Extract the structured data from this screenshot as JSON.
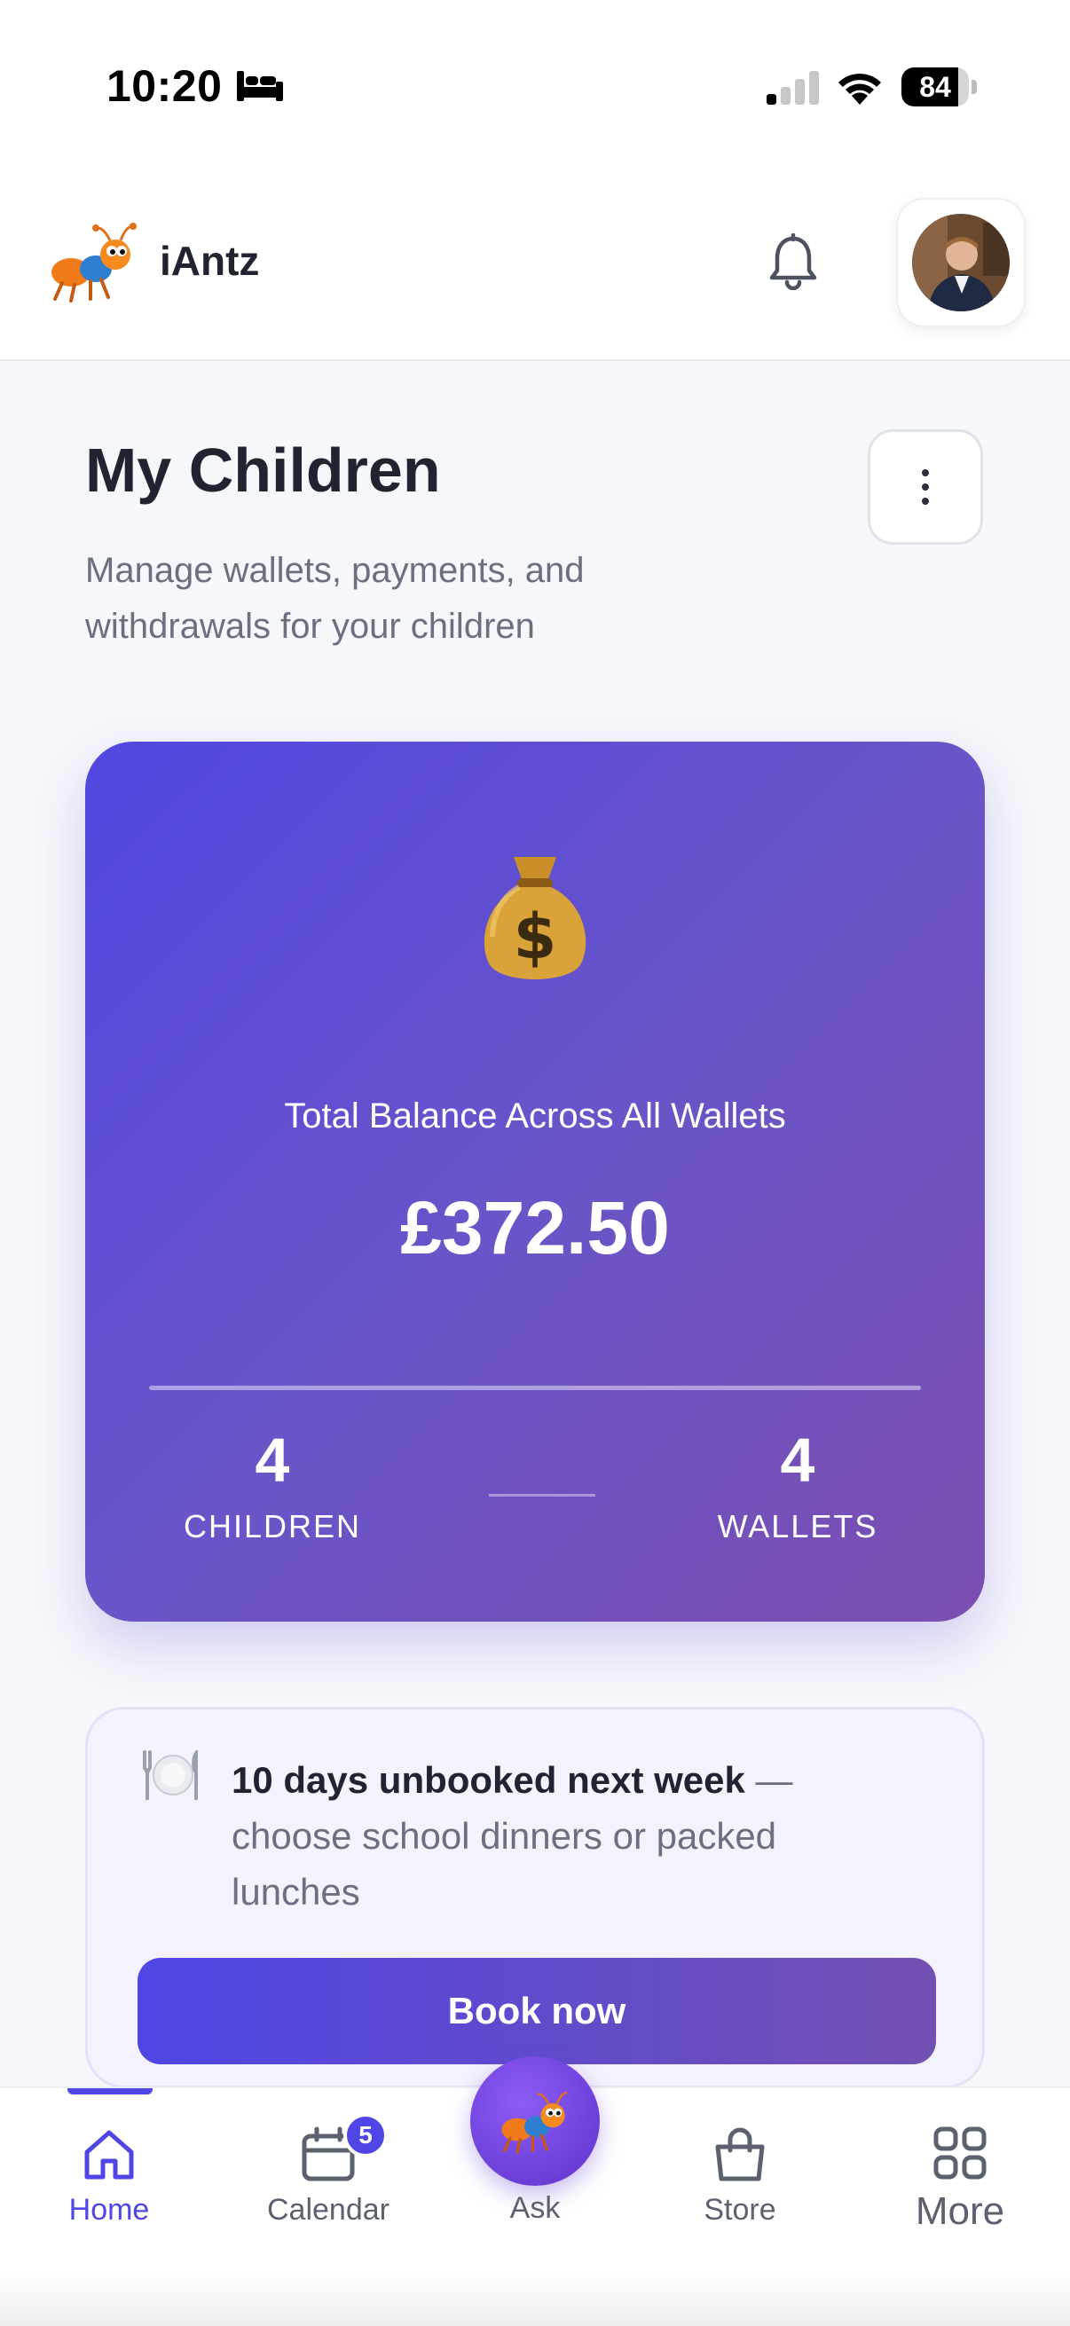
{
  "status_bar": {
    "time": "10:20",
    "battery_level": 84,
    "battery_text": "84",
    "icons": [
      "bed-icon",
      "cellular-signal-icon",
      "wifi-icon",
      "battery-icon"
    ]
  },
  "header": {
    "app_name": "iAntz",
    "logo_icon": "ant-mascot-icon",
    "notification_icon": "bell-icon",
    "avatar_icon": "user-avatar"
  },
  "page": {
    "title": "My Children",
    "subtitle": "Manage wallets, payments, and withdrawals for your children",
    "menu_icon": "vertical-dots-icon"
  },
  "balance_card": {
    "icon": "money-bag-icon",
    "label": "Total Balance Across All Wallets",
    "value": "£372.50",
    "children_count": "4",
    "children_label": "CHILDREN",
    "wallets_count": "4",
    "wallets_label": "WALLETS",
    "gradient_colors": [
      "#5147e0",
      "#7b4fb0"
    ]
  },
  "notice": {
    "icon": "plate-cutlery-icon",
    "strong_text": "10 days unbooked next week",
    "dash": " —",
    "body_text": " choose school dinners or packed lunches",
    "button_label": "Book now"
  },
  "bottom_nav": {
    "items": [
      {
        "label": "Home",
        "icon": "home-icon",
        "active": true
      },
      {
        "label": "Calendar",
        "icon": "calendar-icon",
        "badge": "5"
      },
      {
        "label": "Ask",
        "icon": "ant-mascot-icon"
      },
      {
        "label": "Store",
        "icon": "shopping-bag-icon"
      },
      {
        "label": "More",
        "icon": "grid-icon"
      }
    ]
  },
  "colors": {
    "accent": "#4f46e5",
    "text_primary": "#1f2430",
    "text_secondary": "#6b7080"
  }
}
